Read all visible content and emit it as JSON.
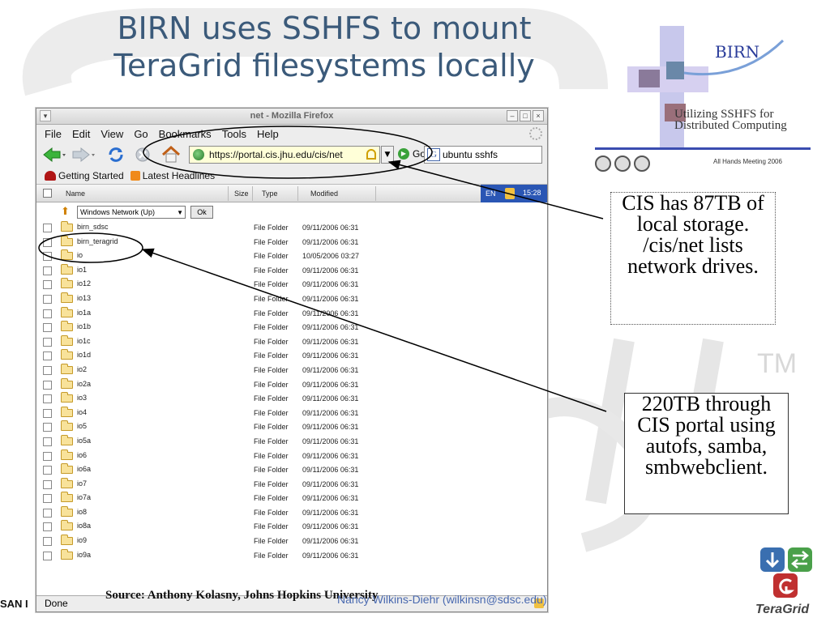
{
  "slide": {
    "title": "BIRN uses SSHFS to mount TeraGrid filesystems locally",
    "source": "Source:  Anthony Kolasny, Johns Hopkins University",
    "author": "Nancy Wilkins-Diehr (wilkinsn@sdsc.edu)",
    "left_footer": "SAN I",
    "tm": "TM",
    "teragrid_wordmark": "TeraGrid"
  },
  "birn_logo": {
    "word": "BIRN",
    "subtitle": "Utilizing SSHFS for Distributed Computing",
    "meeting": "All Hands Meeting 2006"
  },
  "callouts": {
    "storage": "CIS has 87TB of local storage. /cis/net lists network drives.",
    "portal": "220TB through CIS portal using autofs, samba, smbwebclient."
  },
  "browser": {
    "window_title": "net - Mozilla Firefox",
    "menu": [
      "File",
      "Edit",
      "View",
      "Go",
      "Bookmarks",
      "Tools",
      "Help"
    ],
    "url": "https://portal.cis.jhu.edu/cis/net",
    "go_label": "Go",
    "search_value": "ubuntu sshfs",
    "bookmarks": [
      "Getting Started",
      "Latest Headlines"
    ],
    "status": "Done"
  },
  "listing": {
    "columns": {
      "name": "Name",
      "size": "Size",
      "type": "Type",
      "modified": "Modified"
    },
    "tray": {
      "lang": "EN",
      "time": "15:28"
    },
    "location": "Windows Network (Up)",
    "ok_label": "Ok",
    "rows": [
      {
        "name": "birn_sdsc",
        "type": "File Folder",
        "modified": "09/11/2006 06:31"
      },
      {
        "name": "birn_teragrid",
        "type": "File Folder",
        "modified": "09/11/2006 06:31"
      },
      {
        "name": "io",
        "type": "File Folder",
        "modified": "10/05/2006 03:27"
      },
      {
        "name": "io1",
        "type": "File Folder",
        "modified": "09/11/2006 06:31"
      },
      {
        "name": "io12",
        "type": "File Folder",
        "modified": "09/11/2006 06:31"
      },
      {
        "name": "io13",
        "type": "File Folder",
        "modified": "09/11/2006 06:31"
      },
      {
        "name": "io1a",
        "type": "File Folder",
        "modified": "09/11/2006 06:31"
      },
      {
        "name": "io1b",
        "type": "File Folder",
        "modified": "09/11/2006 06:31"
      },
      {
        "name": "io1c",
        "type": "File Folder",
        "modified": "09/11/2006 06:31"
      },
      {
        "name": "io1d",
        "type": "File Folder",
        "modified": "09/11/2006 06:31"
      },
      {
        "name": "io2",
        "type": "File Folder",
        "modified": "09/11/2006 06:31"
      },
      {
        "name": "io2a",
        "type": "File Folder",
        "modified": "09/11/2006 06:31"
      },
      {
        "name": "io3",
        "type": "File Folder",
        "modified": "09/11/2006 06:31"
      },
      {
        "name": "io4",
        "type": "File Folder",
        "modified": "09/11/2006 06:31"
      },
      {
        "name": "io5",
        "type": "File Folder",
        "modified": "09/11/2006 06:31"
      },
      {
        "name": "io5a",
        "type": "File Folder",
        "modified": "09/11/2006 06:31"
      },
      {
        "name": "io6",
        "type": "File Folder",
        "modified": "09/11/2006 06:31"
      },
      {
        "name": "io6a",
        "type": "File Folder",
        "modified": "09/11/2006 06:31"
      },
      {
        "name": "io7",
        "type": "File Folder",
        "modified": "09/11/2006 06:31"
      },
      {
        "name": "io7a",
        "type": "File Folder",
        "modified": "09/11/2006 06:31"
      },
      {
        "name": "io8",
        "type": "File Folder",
        "modified": "09/11/2006 06:31"
      },
      {
        "name": "io8a",
        "type": "File Folder",
        "modified": "09/11/2006 06:31"
      },
      {
        "name": "io9",
        "type": "File Folder",
        "modified": "09/11/2006 06:31"
      },
      {
        "name": "io9a",
        "type": "File Folder",
        "modified": "09/11/2006 06:31"
      }
    ]
  },
  "icons": {
    "back": "back-arrow-icon",
    "forward": "forward-arrow-icon",
    "reload": "reload-icon",
    "stop": "stop-icon",
    "home": "home-icon",
    "lock": "lock-icon",
    "folder": "folder-icon"
  },
  "colors": {
    "title": "#3b5a7a",
    "author": "#4a6ab0",
    "tray": "#2a56b4",
    "birn_rule": "#3a4db0"
  }
}
